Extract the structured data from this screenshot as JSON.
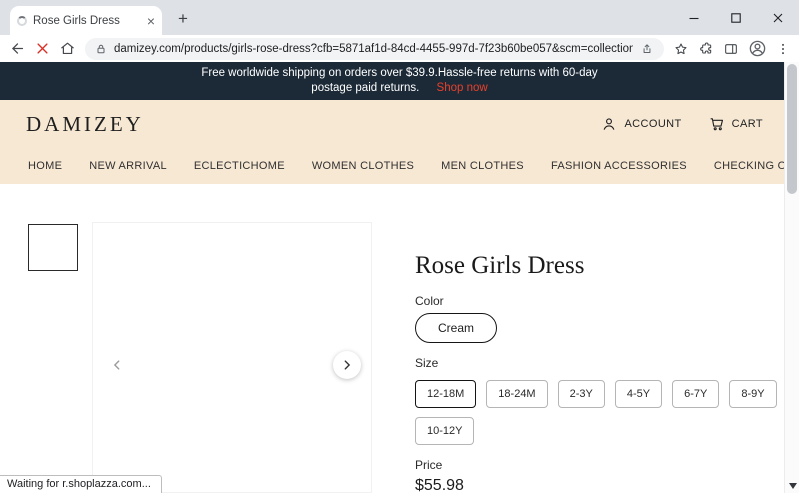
{
  "browser": {
    "tab_title": "Rose Girls Dress",
    "url": "damizey.com/products/girls-rose-dress?cfb=5871af1d-84cd-4455-997d-7f23b60be057&scm=collection.v16&score=0.90000004347...",
    "status": "Waiting for r.shoplazza.com..."
  },
  "announcement": {
    "line1": "Free worldwide shipping on orders over $39.9.Hassle-free returns with 60-day",
    "line2": "postage paid returns.",
    "cta": "Shop now"
  },
  "header": {
    "logo": "DAMIZEY",
    "account_label": "ACCOUNT",
    "cart_label": "CART"
  },
  "nav": {
    "items": [
      "HOME",
      "NEW ARRIVAL",
      "ECLECTICHOME",
      "WOMEN CLOTHES",
      "MEN CLOTHES",
      "FASHION ACCESSORIES",
      "CHECKING ORDER"
    ]
  },
  "product": {
    "title": "Rose Girls Dress",
    "color_label": "Color",
    "color_options": [
      "Cream"
    ],
    "selected_color": "Cream",
    "size_label": "Size",
    "size_options": [
      "12-18M",
      "18-24M",
      "2-3Y",
      "4-5Y",
      "6-7Y",
      "8-9Y",
      "10-12Y"
    ],
    "selected_size": "12-18M",
    "price_label": "Price",
    "price": "$55.98"
  },
  "theme": {
    "announcement_bg": "#1c2a38",
    "header_bg": "#f7e8d4",
    "accent_red": "#e8402a",
    "stop_icon_red": "#d93025"
  }
}
